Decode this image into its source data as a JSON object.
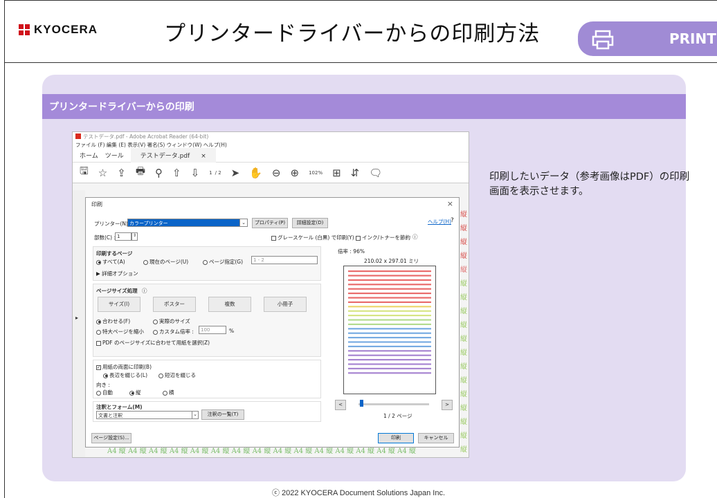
{
  "header": {
    "brand": "KYOCERA",
    "title": "プリンタードライバーからの印刷方法",
    "badge": "PRINT",
    "badge_icon": "printer-icon"
  },
  "card": {
    "heading": "プリンタードライバーからの印刷",
    "description": "印刷したいデータ（参考画像はPDF）の印刷画面を表示させます。"
  },
  "footer": "ⓒ 2022 KYOCERA Document Solutions Japan Inc.",
  "colors": {
    "accent": "#a48ad9",
    "card_bg": "#e3dcf2",
    "logo_red": "#d0121b"
  },
  "app": {
    "window_title": "テストデータ.pdf - Adobe Acrobat Reader (64-bit)",
    "menu": "ファイル (F)   編集 (E)   表示(V)   署名(S)   ウィンドウ(W)   ヘルプ(H)",
    "tabs": {
      "home": "ホーム",
      "tools": "ツール",
      "doc": "テストデータ.pdf",
      "close": "×"
    },
    "toolbar": {
      "page_current": "1",
      "page_total": "/ 2",
      "zoom": "102%"
    },
    "margin_char": "縦",
    "margin_bottom": "A4 縦 A4 縦 A4 縦 A4 縦 A4 縦 A4 縦 A4 縦 A4 縦 A4 縦 A4 縦 A4 縦 A4 縦 A4 縦 A4 縦 A4 縦"
  },
  "dialog": {
    "title": "印刷",
    "close": "×",
    "help": "ヘルプ(H)",
    "printer_label": "プリンター(N) :",
    "printer_value": "カラープリンター",
    "properties": "プロパティ(P)",
    "advanced": "詳細設定(D)",
    "copies_label": "部数(C) :",
    "copies_value": "1",
    "grayscale": "グレースケール (白黒) で印刷(Y)",
    "save_ink": "インク/トナーを節約",
    "pages_title": "印刷するページ",
    "all": "すべて(A)",
    "current": "現在のページ(U)",
    "specify": "ページ指定(G)",
    "range": "1 - 2",
    "more_options": "▶ 詳細オプション",
    "size_title": "ページサイズ処理",
    "size_btns": [
      "サイズ(I)",
      "ポスター",
      "複数",
      "小冊子"
    ],
    "fit": "合わせる(F)",
    "actual": "実際のサイズ",
    "shrink": "特大ページを縮小",
    "custom": "カスタム倍率 :",
    "custom_value": "100",
    "percent": "%",
    "pdf_paper": "PDF のページサイズに合わせて用紙を選択(Z)",
    "duplex": "用紙の両面に印刷(B)",
    "long_edge": "長辺を綴じる(L)",
    "short_edge": "短辺を綴じる",
    "orient_label": "向き :",
    "auto": "自動",
    "portrait": "縦",
    "landscape": "横",
    "comments_title": "注釈とフォーム(M)",
    "comments_value": "文書と注釈",
    "comments_list": "注釈の一覧(T)",
    "page_setup": "ページ設定(S)...",
    "print": "印刷",
    "cancel": "キャンセル",
    "scale": "倍率 : 96%",
    "paper_size": "210.02 x 297.01 ミリ",
    "page_indicator": "1 / 2 ページ",
    "prev": "<",
    "next": ">"
  }
}
